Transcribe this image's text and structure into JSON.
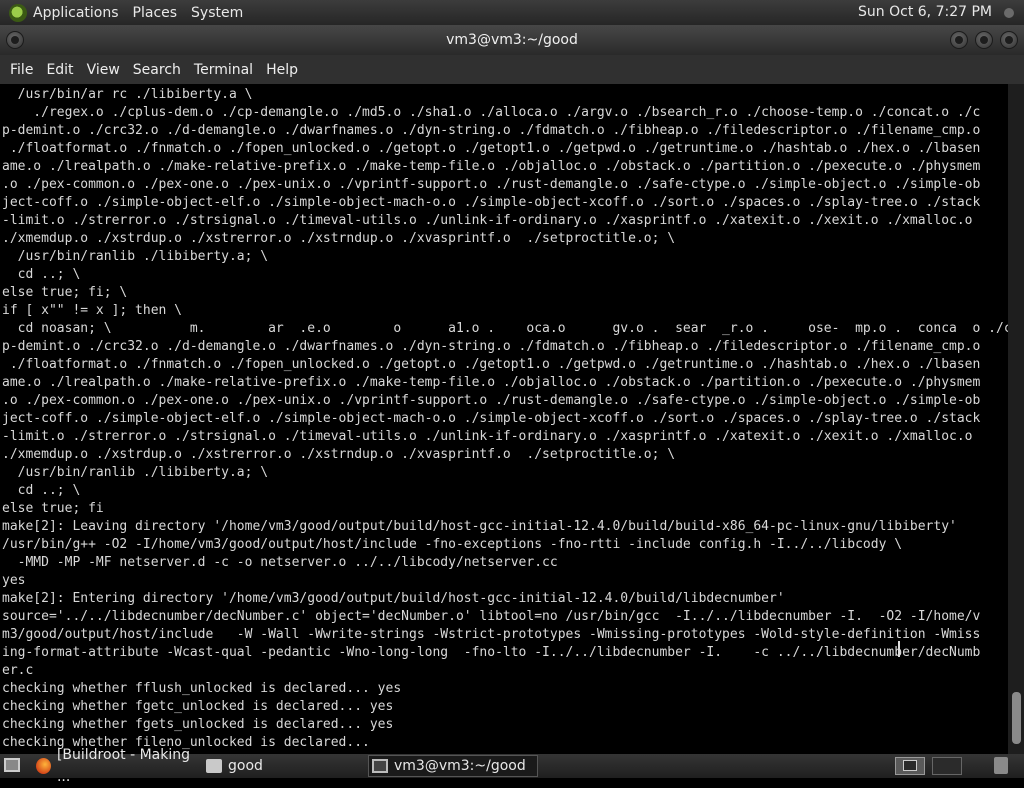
{
  "top_panel": {
    "menus": [
      "Applications",
      "Places",
      "System"
    ],
    "clock": "Sun Oct  6,  7:27 PM"
  },
  "window": {
    "title": "vm3@vm3:~/good"
  },
  "menubar": {
    "items": [
      "File",
      "Edit",
      "View",
      "Search",
      "Terminal",
      "Help"
    ]
  },
  "terminal": {
    "lines": [
      "  /usr/bin/ar rc ./libiberty.a \\",
      "    ./regex.o ./cplus-dem.o ./cp-demangle.o ./md5.o ./sha1.o ./alloca.o ./argv.o ./bsearch_r.o ./choose-temp.o ./concat.o ./c",
      "p-demint.o ./crc32.o ./d-demangle.o ./dwarfnames.o ./dyn-string.o ./fdmatch.o ./fibheap.o ./filedescriptor.o ./filename_cmp.o",
      " ./floatformat.o ./fnmatch.o ./fopen_unlocked.o ./getopt.o ./getopt1.o ./getpwd.o ./getruntime.o ./hashtab.o ./hex.o ./lbasen",
      "ame.o ./lrealpath.o ./make-relative-prefix.o ./make-temp-file.o ./objalloc.o ./obstack.o ./partition.o ./pexecute.o ./physmem",
      ".o ./pex-common.o ./pex-one.o ./pex-unix.o ./vprintf-support.o ./rust-demangle.o ./safe-ctype.o ./simple-object.o ./simple-ob",
      "ject-coff.o ./simple-object-elf.o ./simple-object-mach-o.o ./simple-object-xcoff.o ./sort.o ./spaces.o ./splay-tree.o ./stack",
      "-limit.o ./strerror.o ./strsignal.o ./timeval-utils.o ./unlink-if-ordinary.o ./xasprintf.o ./xatexit.o ./xexit.o ./xmalloc.o",
      "./xmemdup.o ./xstrdup.o ./xstrerror.o ./xstrndup.o ./xvasprintf.o  ./setproctitle.o; \\",
      "  /usr/bin/ranlib ./libiberty.a; \\",
      "  cd ..; \\",
      "else true; fi; \\",
      "if [ x\"\" != x ]; then \\",
      "  cd noasan; \\          m.        ar  .e.o        o      a1.o .    oca.o      gv.o .  sear  _r.o .     ose-  mp.o .  conca  o ./c",
      "p-demint.o ./crc32.o ./d-demangle.o ./dwarfnames.o ./dyn-string.o ./fdmatch.o ./fibheap.o ./filedescriptor.o ./filename_cmp.o",
      " ./floatformat.o ./fnmatch.o ./fopen_unlocked.o ./getopt.o ./getopt1.o ./getpwd.o ./getruntime.o ./hashtab.o ./hex.o ./lbasen",
      "ame.o ./lrealpath.o ./make-relative-prefix.o ./make-temp-file.o ./objalloc.o ./obstack.o ./partition.o ./pexecute.o ./physmem",
      ".o ./pex-common.o ./pex-one.o ./pex-unix.o ./vprintf-support.o ./rust-demangle.o ./safe-ctype.o ./simple-object.o ./simple-ob",
      "ject-coff.o ./simple-object-elf.o ./simple-object-mach-o.o ./simple-object-xcoff.o ./sort.o ./spaces.o ./splay-tree.o ./stack",
      "-limit.o ./strerror.o ./strsignal.o ./timeval-utils.o ./unlink-if-ordinary.o ./xasprintf.o ./xatexit.o ./xexit.o ./xmalloc.o",
      "./xmemdup.o ./xstrdup.o ./xstrerror.o ./xstrndup.o ./xvasprintf.o  ./setproctitle.o; \\",
      "  /usr/bin/ranlib ./libiberty.a; \\",
      "  cd ..; \\",
      "else true; fi",
      "make[2]: Leaving directory '/home/vm3/good/output/build/host-gcc-initial-12.4.0/build/build-x86_64-pc-linux-gnu/libiberty'",
      "/usr/bin/g++ -O2 -I/home/vm3/good/output/host/include -fno-exceptions -fno-rtti -include config.h -I../../libcody \\",
      "  -MMD -MP -MF netserver.d -c -o netserver.o ../../libcody/netserver.cc",
      "yes",
      "make[2]: Entering directory '/home/vm3/good/output/build/host-gcc-initial-12.4.0/build/libdecnumber'",
      "source='../../libdecnumber/decNumber.c' object='decNumber.o' libtool=no /usr/bin/gcc  -I../../libdecnumber -I.  -O2 -I/home/v",
      "m3/good/output/host/include   -W -Wall -Wwrite-strings -Wstrict-prototypes -Wmissing-prototypes -Wold-style-definition -Wmiss",
      "ing-format-attribute -Wcast-qual -pedantic -Wno-long-long  -fno-lto -I../../libdecnumber -I.    -c ../../libdecnumber/decNumb",
      "er.c",
      "checking whether fflush_unlocked is declared... yes",
      "checking whether fgetc_unlocked is declared... yes",
      "checking whether fgets_unlocked is declared... yes",
      "checking whether fileno_unlocked is declared..."
    ]
  },
  "taskbar": {
    "tasks": [
      {
        "label": "[Buildroot - Making ...",
        "icon": "firefox-icon"
      },
      {
        "label": "good",
        "icon": "folder-icon"
      },
      {
        "label": "vm3@vm3:~/good",
        "icon": "terminal-icon"
      }
    ]
  }
}
